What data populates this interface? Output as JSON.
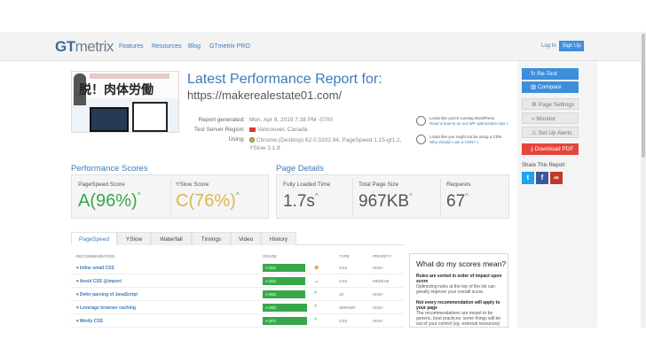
{
  "header": {
    "logo_gt": "GT",
    "logo_metrix": "metrix",
    "nav": [
      "Features",
      "Resources",
      "Blog",
      "GTmetrix PRO"
    ],
    "login": "Log In",
    "signup": "Sign Up"
  },
  "report": {
    "title": "Latest Performance Report for:",
    "url": "https://makerealestate01.com/",
    "generated_label": "Report generated:",
    "generated_value": "Mon, Apr 8, 2019 7:38 PM -0700",
    "region_label": "Test Server Region:",
    "region_value": "Vancouver, Canada",
    "using_label": "Using:",
    "using_value": "Chrome (Desktop) 62.0.3202.94, PageSpeed 1.15-gt1.2, YSlow 3.1.8"
  },
  "thumbnail": {
    "jp_headline": "脱！肉体労働"
  },
  "tips": [
    {
      "text": "Looks like you're running WordPress",
      "link": "Read a how-to on our WP optimization tips »"
    },
    {
      "text": "Looks like you might not be using a CDN",
      "link": "Why should I use a CDN? »"
    }
  ],
  "scores": {
    "title": "Performance Scores",
    "pagespeed_label": "PageSpeed Score",
    "pagespeed_grade": "A",
    "pagespeed_value": "(96%)",
    "yslow_label": "YSlow Score",
    "yslow_grade": "C",
    "yslow_value": "(76%)",
    "trend_icon": "^"
  },
  "details": {
    "title": "Page Details",
    "load_label": "Fully Loaded Time",
    "load_value": "1.7s",
    "size_label": "Total Page Size",
    "size_value": "967KB",
    "requests_label": "Requests",
    "requests_value": "67"
  },
  "tabs": [
    "PageSpeed",
    "YSlow",
    "Waterfall",
    "Timings",
    "Video",
    "History"
  ],
  "table": {
    "headers": [
      "RECOMMENDATION",
      "GRADE",
      "TYPE",
      "PRIORITY"
    ],
    "rows": [
      {
        "name": "▾ Inline small CSS",
        "grade": "A (92)",
        "indicator": "◆",
        "type": "CSS",
        "priority": "HIGH"
      },
      {
        "name": "▾ Avoid CSS @import",
        "grade": "A (92)",
        "indicator": "⌄",
        "type": "CSS",
        "priority": "MEDIUM"
      },
      {
        "name": "▾ Defer parsing of JavaScript",
        "grade": "A (92)",
        "indicator": "^",
        "type": "JS",
        "priority": "HIGH"
      },
      {
        "name": "▾ Leverage browser caching",
        "grade": "A (96)",
        "indicator": "^",
        "type": "SERVER",
        "priority": "HIGH"
      },
      {
        "name": "▾ Minify CSS",
        "grade": "A (97)",
        "indicator": "^",
        "type": "CSS",
        "priority": "HIGH"
      }
    ]
  },
  "help": {
    "title": "What do my scores mean?",
    "b1": "Rules are sorted in order of impact upon score",
    "t1": "Optimizing rules at the top of the list can greatly improve your overall score.",
    "b2": "Not every recommendation will apply to your page",
    "t2": "The recommendations are meant to be generic, best practices; some things will be out of your control (eg. external resources) or may not apply to your page."
  },
  "sidebar": {
    "retest": "↻ Re-Test",
    "compare": "▥ Compare",
    "page_settings": "⚙ Page Settings",
    "monitor": "≈ Monitor",
    "alerts": "⚠ Set Up Alerts",
    "pdf": "⤓ Download PDF",
    "share_label": "Share This Report",
    "share_icons": [
      "t",
      "f",
      "∞"
    ]
  },
  "colors": {
    "accent": "#3d7ab8",
    "button_blue": "#3d8edb",
    "grade_green": "#36a84a",
    "grade_yellow": "#d9b84d",
    "pdf_red": "#e4463c"
  }
}
